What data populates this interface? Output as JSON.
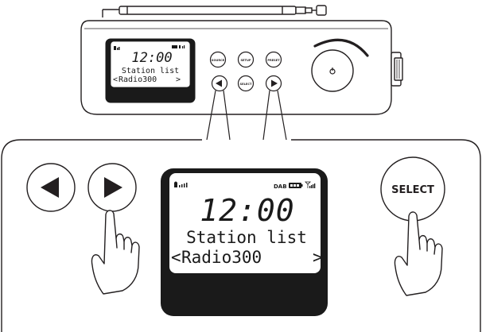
{
  "radio": {
    "lcd": {
      "time": "12:00",
      "line1": "Station list",
      "line2_left": "<",
      "line2_station": "Radio300",
      "line2_right": ">"
    },
    "buttons": {
      "source": "SOURCE",
      "setup": "SETUP",
      "preset": "PRESET",
      "select": "SELECT"
    }
  },
  "detail": {
    "lcd": {
      "status_dab": "DAB",
      "time": "12:00",
      "line1": "Station list",
      "line2_left": "<",
      "line2_station": "Radio300",
      "line2_right": ">"
    },
    "select_button": "SELECT"
  },
  "colors": {
    "outline": "#231f20",
    "lcd_bezel": "#1a1a1a",
    "lcd_screen": "#ffffff"
  }
}
